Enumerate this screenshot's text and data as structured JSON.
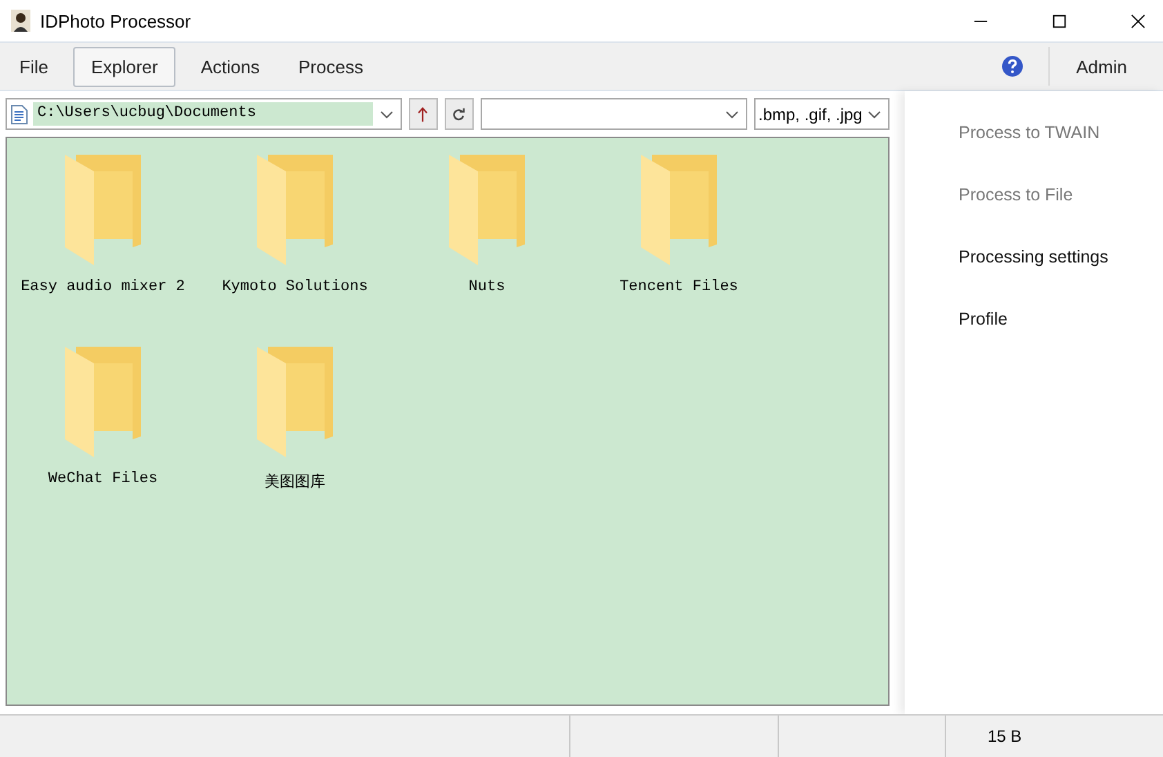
{
  "window": {
    "title": "IDPhoto Processor"
  },
  "menu": [
    {
      "label": "File",
      "selected": false
    },
    {
      "label": "Explorer",
      "selected": true
    },
    {
      "label": "Actions",
      "selected": false
    },
    {
      "label": "Process",
      "selected": false
    }
  ],
  "admin": {
    "label": "Admin"
  },
  "toolbar": {
    "path": "C:\\Users\\ucbug\\Documents",
    "filter": ".bmp, .gif, .jpg"
  },
  "folders": [
    {
      "name": "Easy audio mixer 2"
    },
    {
      "name": "Kymoto Solutions"
    },
    {
      "name": "Nuts"
    },
    {
      "name": "Tencent Files"
    },
    {
      "name": "WeChat Files"
    },
    {
      "name": "美图图库"
    }
  ],
  "actions": [
    {
      "label": "Process to TWAIN",
      "disabled": true
    },
    {
      "label": "Process to File",
      "disabled": true
    },
    {
      "label": "Processing settings",
      "disabled": false
    },
    {
      "label": "Profile",
      "disabled": false
    }
  ],
  "status_bar": {
    "size": "15 B"
  }
}
